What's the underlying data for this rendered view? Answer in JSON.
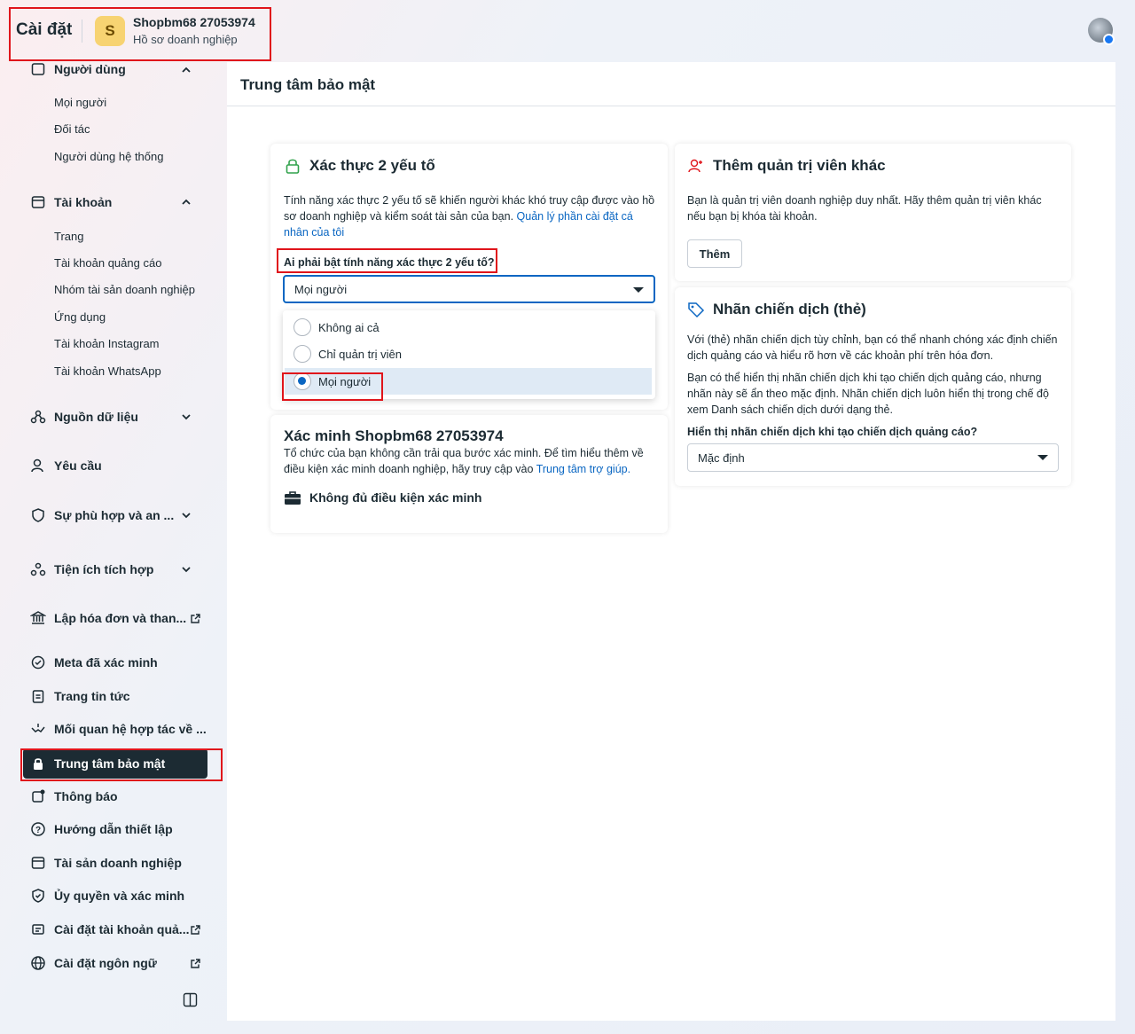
{
  "header": {
    "title": "Cài đặt",
    "business_initial": "S",
    "business_name": "Shopbm68 27053974",
    "business_subtitle": "Hồ sơ doanh nghiệp"
  },
  "sidebar": {
    "section_users": "Người dùng",
    "users_items": [
      "Mọi người",
      "Đối tác",
      "Người dùng hệ thống"
    ],
    "section_accounts": "Tài khoản",
    "accounts_items": [
      "Trang",
      "Tài khoản quảng cáo",
      "Nhóm tài sản doanh nghiệp",
      "Ứng dụng",
      "Tài khoản Instagram",
      "Tài khoản WhatsApp"
    ],
    "data_sources": "Nguồn dữ liệu",
    "requests": "Yêu cầu",
    "compliance": "Sự phù hợp và an ...",
    "integrations": "Tiện ích tích hợp",
    "billing": "Lập hóa đơn và than...",
    "meta_verified": "Meta đã xác minh",
    "news_page": "Trang tin tức",
    "partner_relations": "Mối quan hệ hợp tác về ...",
    "security_center": "Trung tâm bảo mật",
    "notifications": "Thông báo",
    "setup_guide": "Hướng dẫn thiết lập",
    "business_assets": "Tài sản doanh nghiệp",
    "authorization": "Ủy quyền và xác minh",
    "ad_account_settings": "Cài đặt tài khoản quả...",
    "language_settings": "Cài đặt ngôn ngữ"
  },
  "main": {
    "title": "Trung tâm bảo mật",
    "two_factor": {
      "title": "Xác thực 2 yếu tố",
      "description": "Tính năng xác thực 2 yếu tố sẽ khiến người khác khó truy cập được vào hồ sơ doanh nghiệp và kiểm soát tài sản của bạn.",
      "link": "Quản lý phần cài đặt cá nhân của tôi",
      "question": "Ai phải bật tính năng xác thực 2 yếu tố?",
      "selected": "Mọi người",
      "options": [
        "Không ai cả",
        "Chỉ quản trị viên",
        "Mọi người"
      ]
    },
    "verification": {
      "title": "Xác minh Shopbm68 27053974",
      "description": "Tổ chức của bạn không cần trải qua bước xác minh. Để tìm hiểu thêm về điều kiện xác minh doanh nghiệp, hãy truy cập vào",
      "link": "Trung tâm trợ giúp.",
      "status": "Không đủ điều kiện xác minh"
    },
    "admins": {
      "title": "Thêm quản trị viên khác",
      "description": "Bạn là quản trị viên doanh nghiệp duy nhất. Hãy thêm quản trị viên khác nếu bạn bị khóa tài khoản.",
      "button": "Thêm"
    },
    "campaign_tags": {
      "title": "Nhãn chiến dịch (thẻ)",
      "description1": "Với (thẻ) nhãn chiến dịch tùy chỉnh, bạn có thể nhanh chóng xác định chiến dịch quảng cáo và hiểu rõ hơn về các khoản phí trên hóa đơn.",
      "description2": "Bạn có thể hiển thị nhãn chiến dịch khi tạo chiến dịch quảng cáo, nhưng nhãn này sẽ ẩn theo mặc định. Nhãn chiến dịch luôn hiển thị trong chế độ xem Danh sách chiến dịch dưới dạng thẻ.",
      "question": "Hiển thị nhãn chiến dịch khi tạo chiến dịch quảng cáo?",
      "selected": "Mặc định"
    }
  },
  "colors": {
    "highlight": "#e0151b",
    "link": "#0a66c2",
    "active_nav": "#1c2b33",
    "avatar": "#f7d372"
  }
}
